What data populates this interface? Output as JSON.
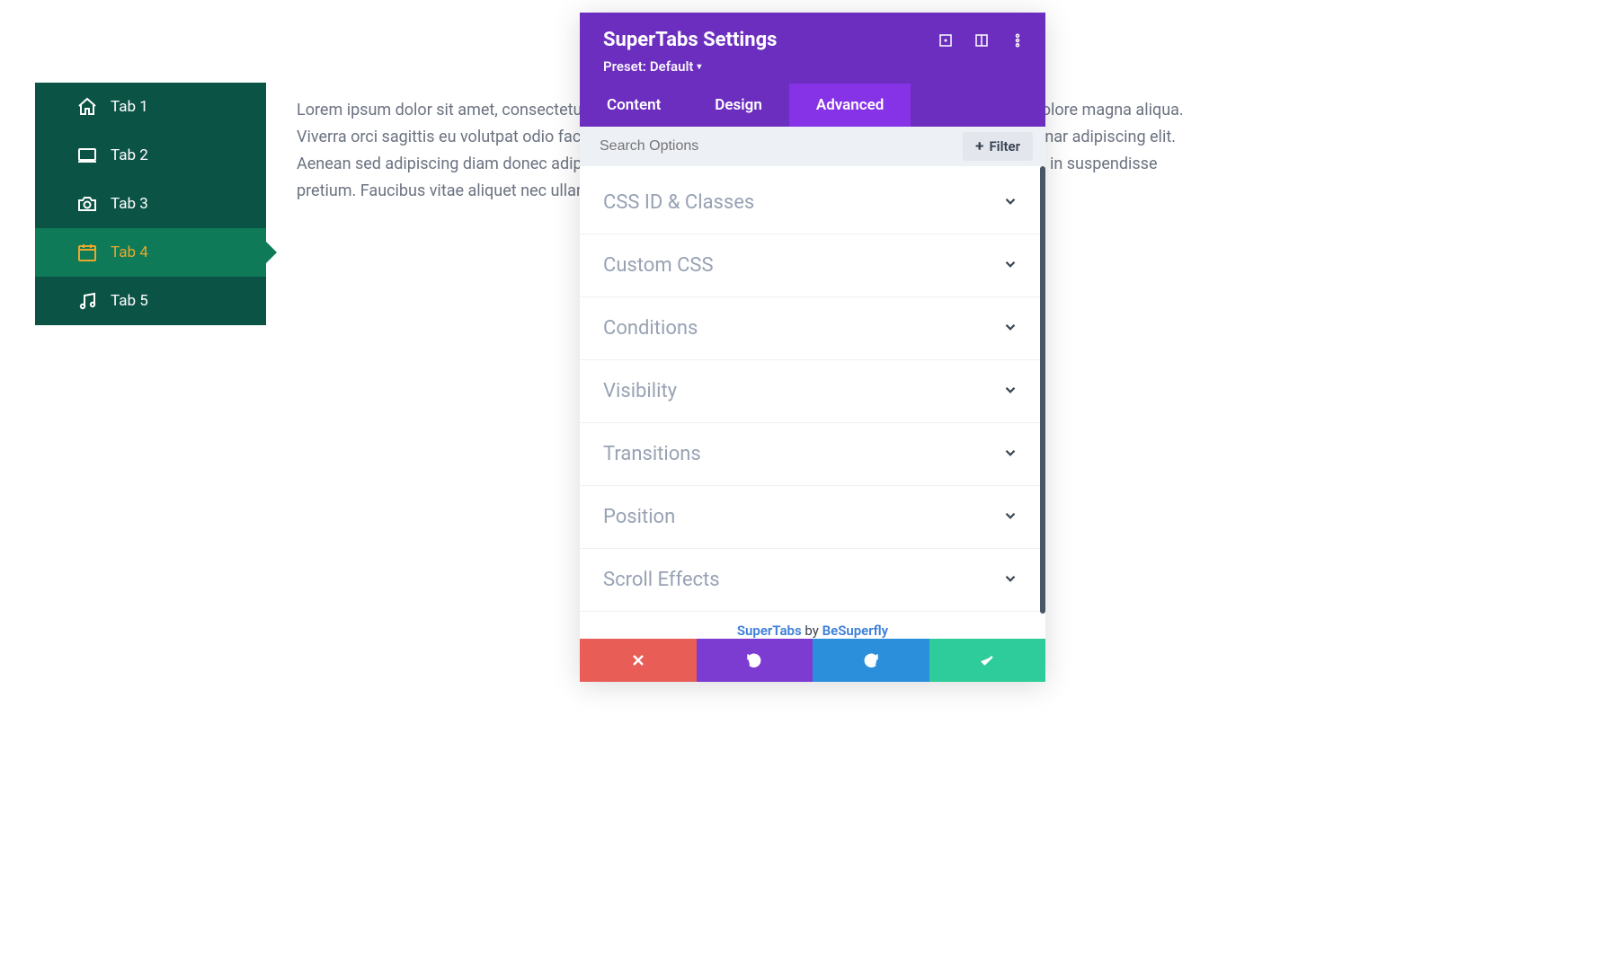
{
  "tabs": {
    "items": [
      {
        "label": "Tab 1",
        "icon": "home-icon",
        "active": false
      },
      {
        "label": "Tab 2",
        "icon": "laptop-icon",
        "active": false
      },
      {
        "label": "Tab 3",
        "icon": "camera-icon",
        "active": false
      },
      {
        "label": "Tab 4",
        "icon": "calendar-icon",
        "active": true
      },
      {
        "label": "Tab 5",
        "icon": "music-icon",
        "active": false
      }
    ]
  },
  "body_text": "Lorem ipsum dolor sit amet, consectetur adipiscing elit, sed do eiusmod tempor incididunt ut labore et dolore magna aliqua. Viverra orci sagittis eu volutpat odio facilisis mauris sit amet massa. Consectetur purus ut faucibus pulvinar adipiscing elit. Aenean sed adipiscing diam donec adipiscing tristique. Eget mi proin sed libero enim sed faucibus turpis in suspendisse pretium. Faucibus vitae aliquet nec ullamcorper sit amet risus nullam eget felis eget.",
  "modal": {
    "title": "SuperTabs Settings",
    "preset_label": "Preset:",
    "preset_value": "Default",
    "tabs": [
      {
        "label": "Content",
        "active": false
      },
      {
        "label": "Design",
        "active": false
      },
      {
        "label": "Advanced",
        "active": true
      }
    ],
    "search_placeholder": "Search Options",
    "filter_label": "Filter",
    "sections": [
      "CSS ID & Classes",
      "Custom CSS",
      "Conditions",
      "Visibility",
      "Transitions",
      "Position",
      "Scroll Effects"
    ],
    "credit": {
      "product": "SuperTabs",
      "by": "by",
      "author": "BeSuperfly"
    }
  }
}
